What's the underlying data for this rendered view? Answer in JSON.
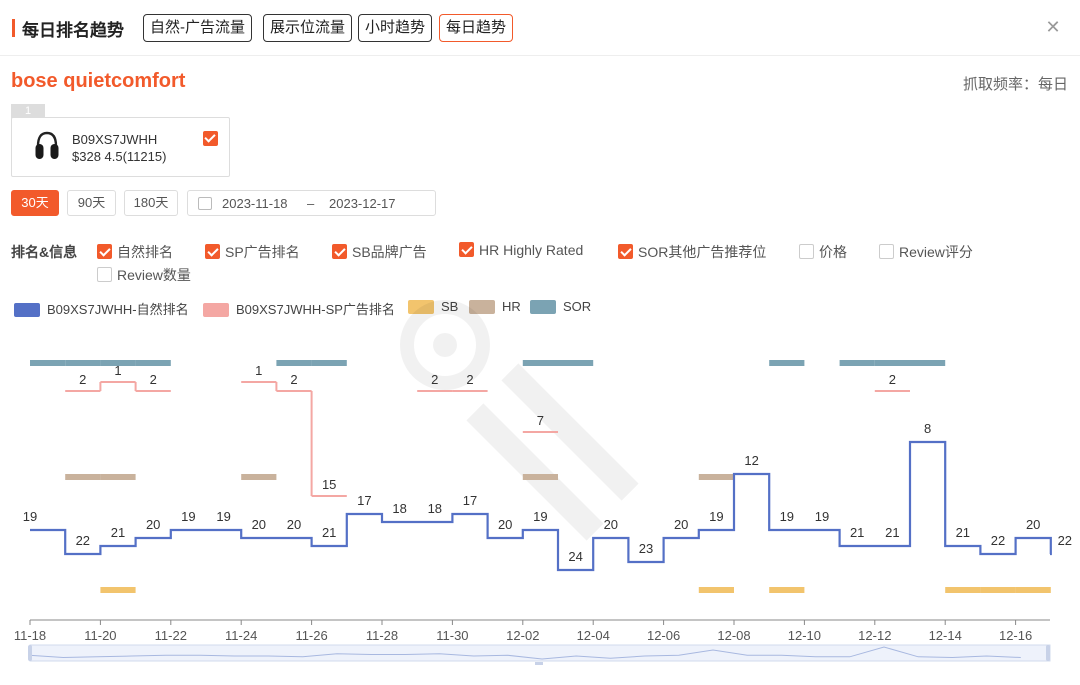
{
  "header": {
    "title": "每日排名趋势",
    "tabs": [
      {
        "label": "自然-广告流量",
        "active": false
      },
      {
        "label": "展示位流量",
        "active": false
      },
      {
        "label": "小时趋势",
        "active": false
      },
      {
        "label": "每日趋势",
        "active": true
      }
    ],
    "close_icon": "close-icon"
  },
  "keyword": "bose quietcomfort",
  "frequency": "抓取频率：每日",
  "product": {
    "index": "1",
    "asin": "B09XS7JWHH",
    "price_rating": "$328 4.5(11215)",
    "selected": true
  },
  "range": {
    "buttons": [
      {
        "label": "30天",
        "active": true
      },
      {
        "label": "90天",
        "active": false
      },
      {
        "label": "180天",
        "active": false
      }
    ],
    "start": "2023-11-18",
    "separator": "–",
    "end": "2023-12-17"
  },
  "filters": {
    "label": "排名&信息",
    "options": [
      {
        "label": "自然排名",
        "checked": true
      },
      {
        "label": "SP广告排名",
        "checked": true
      },
      {
        "label": "SB品牌广告",
        "checked": true
      },
      {
        "label": "HR Highly Rated",
        "checked": true
      },
      {
        "label": "SOR其他广告推荐位",
        "checked": true
      },
      {
        "label": "价格",
        "checked": false
      },
      {
        "label": "Review评分",
        "checked": false
      },
      {
        "label": "Review数量",
        "checked": false
      }
    ]
  },
  "colors": {
    "accent": "#f25a2b",
    "organic": "#5470c6",
    "sp": "#f4a7a3",
    "sb": "#f2c46d",
    "hr": "#c9b29c",
    "sor": "#7ba3b3"
  },
  "chart_data": {
    "type": "line",
    "step": true,
    "x": [
      "11-18",
      "11-19",
      "11-20",
      "11-21",
      "11-22",
      "11-23",
      "11-24",
      "11-25",
      "11-26",
      "11-27",
      "11-28",
      "11-29",
      "11-30",
      "12-01",
      "12-02",
      "12-03",
      "12-04",
      "12-05",
      "12-06",
      "12-07",
      "12-08",
      "12-09",
      "12-10",
      "12-11",
      "12-12",
      "12-13",
      "12-14",
      "12-15",
      "12-16",
      "12-17"
    ],
    "x_tick_labels": [
      "11-18",
      "11-20",
      "11-22",
      "11-24",
      "11-26",
      "11-28",
      "11-30",
      "12-02",
      "12-04",
      "12-06",
      "12-08",
      "12-10",
      "12-12",
      "12-14",
      "12-16"
    ],
    "legend": [
      {
        "name": "B09XS7JWHH-自然排名",
        "color": "#5470c6"
      },
      {
        "name": "B09XS7JWHH-SP广告排名",
        "color": "#f4a7a3"
      },
      {
        "name": "SB",
        "color": "#f2c46d"
      },
      {
        "name": "HR",
        "color": "#c9b29c"
      },
      {
        "name": "SOR",
        "color": "#7ba3b3"
      }
    ],
    "series": [
      {
        "name": "B09XS7JWHH-自然排名",
        "values": [
          19,
          22,
          21,
          20,
          19,
          19,
          20,
          20,
          21,
          17,
          18,
          18,
          17,
          20,
          19,
          24,
          20,
          23,
          20,
          19,
          12,
          19,
          19,
          21,
          21,
          8,
          21,
          22,
          20,
          22
        ]
      },
      {
        "name": "B09XS7JWHH-SP广告排名",
        "values": [
          null,
          2,
          1,
          2,
          null,
          null,
          1,
          2,
          15,
          null,
          null,
          2,
          2,
          null,
          7,
          null,
          null,
          null,
          null,
          null,
          null,
          null,
          null,
          null,
          2,
          null,
          null,
          null,
          null,
          null
        ]
      }
    ],
    "placement_days": {
      "SB": [
        "11-20",
        "12-07",
        "12-09",
        "12-14",
        "12-15",
        "12-16"
      ],
      "HR": [
        "11-19",
        "11-20",
        "11-24",
        "12-02",
        "12-07"
      ],
      "SOR": [
        "11-18",
        "11-19",
        "11-20",
        "11-21",
        "11-25",
        "11-26",
        "12-02",
        "12-03",
        "12-09",
        "12-11",
        "12-12",
        "12-13"
      ]
    },
    "yaxis": {
      "inverse": true,
      "visible": false
    },
    "grid": false,
    "legend_position": "top-left",
    "datazoom": true
  }
}
